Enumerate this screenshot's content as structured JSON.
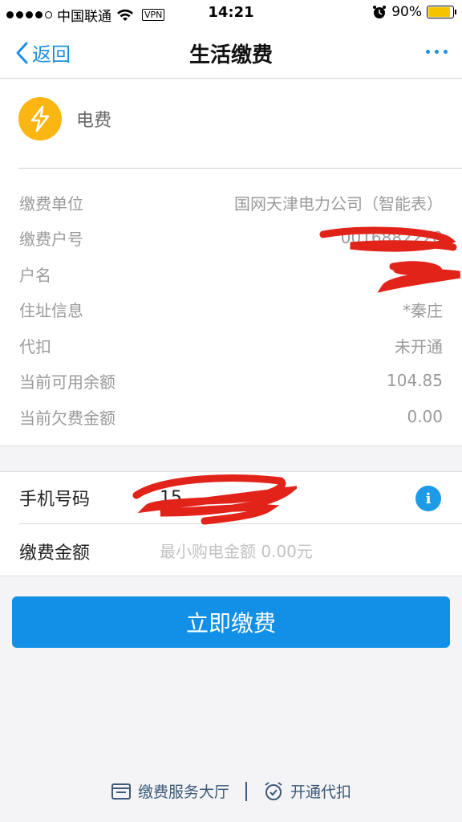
{
  "status_bar": {
    "carrier": "中国联通",
    "vpn": "VPN",
    "time": "14:21",
    "battery": "90%",
    "battery_level": 0.9
  },
  "nav": {
    "back_label": "返回",
    "title": "生活缴费"
  },
  "service": {
    "icon": "lightning-icon",
    "name": "电费"
  },
  "info_rows": [
    {
      "label": "缴费单位",
      "value": "国网天津电力公司（智能表）"
    },
    {
      "label": "缴费户号",
      "value": "0016882228"
    },
    {
      "label": "户名",
      "value": ""
    },
    {
      "label": "住址信息",
      "value": "*秦庄"
    },
    {
      "label": "代扣",
      "value": "未开通"
    },
    {
      "label": "当前可用余额",
      "value": "104.85"
    },
    {
      "label": "当前欠费金额",
      "value": "0.00"
    }
  ],
  "form": {
    "phone_label": "手机号码",
    "phone_value": "15",
    "amount_label": "缴费金额",
    "amount_placeholder": "最小购电金额 0.00元"
  },
  "pay_button": "立即缴费",
  "bottom_links": {
    "service_hall": "缴费服务大厅",
    "auto_debit": "开通代扣"
  },
  "colors": {
    "accent": "#128fe6",
    "icon_bg": "#fbb614",
    "redaction": "#e2231a"
  }
}
